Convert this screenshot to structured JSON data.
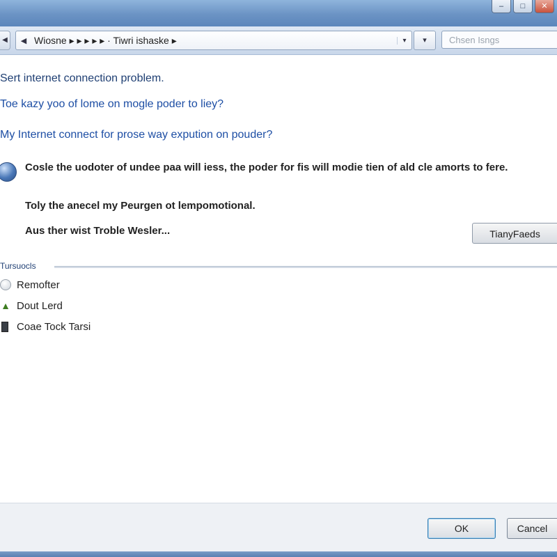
{
  "window": {
    "controls": {
      "minimize": "–",
      "maximize": "□",
      "close": "✕"
    }
  },
  "address_bar": {
    "back_glyph": "◀",
    "breadcrumb": "Wiosne ▸ ▸ ▸ ▸ ▸ · Tiwri ishaske ▸",
    "dropdown_glyph": "▾",
    "refresh_glyph": "▾",
    "search_placeholder": "Chsen Isngs"
  },
  "main": {
    "heading": "Sert internet connection problem.",
    "questions": [
      "Toe kazy yoo of lome on mogle poder to liey?",
      "My Internet connect for prose way expution on pouder?"
    ],
    "result_text": "Cosle the uodoter of undee paa will iess, the poder for fis will modie tien of ald cle amorts to fere.",
    "info_lines": [
      "Toly the anecel my Peurgen ot lempomotional.",
      "Aus ther wist Troble Wesler..."
    ],
    "action_button": "TianyFaeds"
  },
  "section": {
    "label": "Tursuocls",
    "items": [
      {
        "label": "Remofter",
        "icon": "remove-circle-icon"
      },
      {
        "label": "Dout Lerd",
        "icon": "warning-triangle-icon"
      },
      {
        "label": "Coae Tock Tarsi",
        "icon": "document-icon"
      }
    ]
  },
  "footer": {
    "ok_label": "OK",
    "cancel_label": "Cancel"
  },
  "colors": {
    "title_bar": "#6b93c4",
    "link_blue": "#1d4ea4",
    "heading_blue": "#1f3f73",
    "footer_bg": "#eef1f5"
  }
}
